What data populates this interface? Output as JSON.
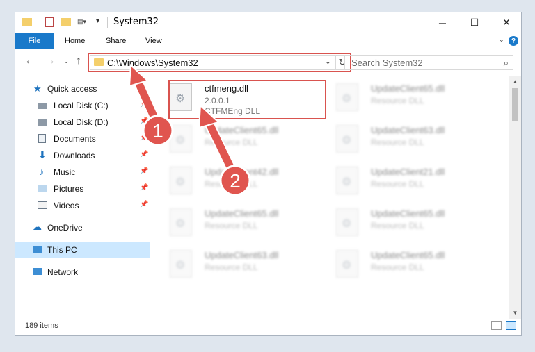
{
  "window": {
    "title": "System32",
    "controls": {
      "minimize": "─",
      "maximize": "☐",
      "close": "✕"
    }
  },
  "ribbon": {
    "file": "File",
    "tabs": [
      "Home",
      "Share",
      "View"
    ],
    "help": "?"
  },
  "navbar": {
    "address": "C:\\Windows\\System32",
    "search_placeholder": "Search System32"
  },
  "sidebar": {
    "items": [
      {
        "label": "Quick access",
        "icon": "star-icon"
      },
      {
        "label": "Local Disk (C:)",
        "icon": "drive-icon"
      },
      {
        "label": "Local Disk (D:)",
        "icon": "drive-icon"
      },
      {
        "label": "Documents",
        "icon": "documents-icon"
      },
      {
        "label": "Downloads",
        "icon": "download-icon"
      },
      {
        "label": "Music",
        "icon": "music-icon"
      },
      {
        "label": "Pictures",
        "icon": "pictures-icon"
      },
      {
        "label": "Videos",
        "icon": "videos-icon"
      },
      {
        "label": "OneDrive",
        "icon": "cloud-icon"
      },
      {
        "label": "This PC",
        "icon": "computer-icon"
      },
      {
        "label": "Network",
        "icon": "network-icon"
      }
    ]
  },
  "files": [
    {
      "name": "ctfmeng.dll",
      "version": "2.0.0.1",
      "type": "CTFMEng DLL"
    },
    {
      "name": "UpdateClient65.dll",
      "type": "Resource DLL"
    },
    {
      "name": "UpdateClient65.dll",
      "type": "Resource DLL"
    },
    {
      "name": "UpdateClient63.dll",
      "type": "Resource DLL"
    },
    {
      "name": "UpdateClient42.dll",
      "type": "Resource DLL"
    },
    {
      "name": "UpdateClient21.dll",
      "type": "Resource DLL"
    },
    {
      "name": "UpdateClient65.dll",
      "type": "Resource DLL"
    },
    {
      "name": "UpdateClient65.dll",
      "type": "Resource DLL"
    },
    {
      "name": "UpdateClient63.dll",
      "type": "Resource DLL"
    },
    {
      "name": "UpdateClient65.dll",
      "type": "Resource DLL"
    }
  ],
  "status": {
    "item_count": "189 items"
  },
  "annotations": {
    "marker1": "1",
    "marker2": "2"
  },
  "colors": {
    "accent": "#1979ca",
    "highlight": "#d9534f",
    "arrow": "#e0554f",
    "selected": "#cce8ff"
  }
}
